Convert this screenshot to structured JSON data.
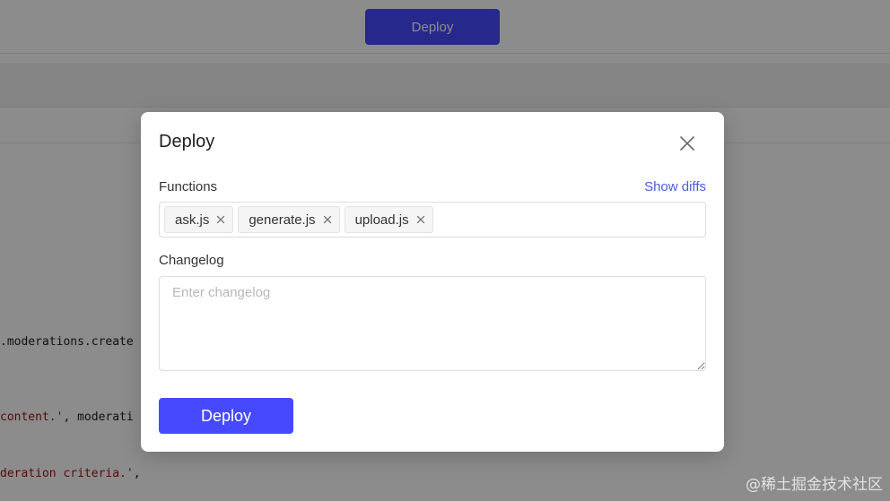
{
  "background": {
    "header_deploy_label": "Deploy",
    "code_lines": [
      ".moderations.create",
      "content.'",
      ", moderati",
      "deration criteria.'",
      ","
    ]
  },
  "modal": {
    "title": "Deploy",
    "close_icon": "close-icon",
    "functions_label": "Functions",
    "show_diffs_label": "Show diffs",
    "functions": [
      {
        "name": "ask.js"
      },
      {
        "name": "generate.js"
      },
      {
        "name": "upload.js"
      }
    ],
    "changelog_label": "Changelog",
    "changelog_placeholder": "Enter changelog",
    "changelog_value": "",
    "deploy_label": "Deploy"
  },
  "colors": {
    "primary": "#4649ff",
    "link": "#4a5de0",
    "overlay": "rgba(0,0,0,0.45)"
  },
  "watermark": "@稀土掘金技术社区"
}
